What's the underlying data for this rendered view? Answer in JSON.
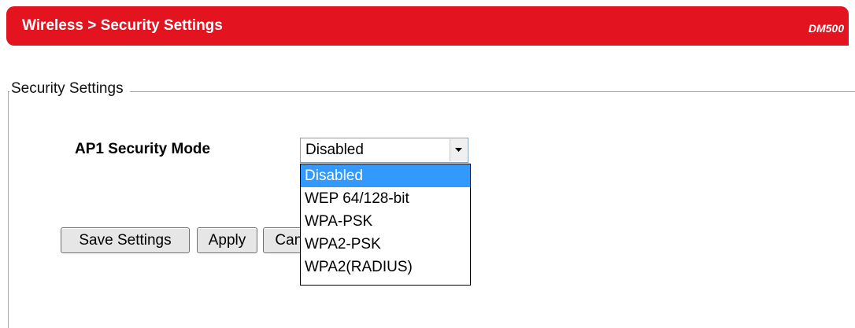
{
  "header": {
    "breadcrumb": "Wireless > Security Settings",
    "model": "DM500",
    "accent_color": "#e3141f"
  },
  "section": {
    "legend": "Security Settings"
  },
  "security_mode": {
    "label": "AP1 Security Mode",
    "selected_value": "Disabled",
    "options": [
      "Disabled",
      "WEP 64/128-bit",
      "WPA-PSK",
      "WPA2-PSK",
      "WPA2(RADIUS)"
    ],
    "highlighted_index": 0,
    "dropdown_open": true
  },
  "buttons": {
    "save": "Save Settings",
    "apply": "Apply",
    "cancel": "Cancel"
  },
  "icons": {
    "select_arrow": "chevron-down-icon"
  }
}
